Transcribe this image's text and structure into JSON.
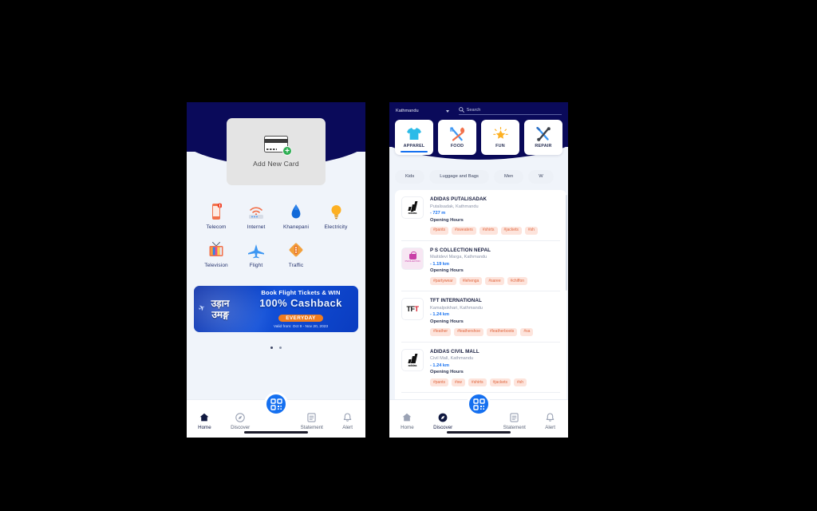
{
  "left_phone": {
    "add_card": {
      "label": "Add New Card",
      "icon": "credit-card-plus-icon"
    },
    "services": [
      {
        "label": "Telecom",
        "icon": "mobile-phone-icon"
      },
      {
        "label": "Internet",
        "icon": "wifi-router-icon"
      },
      {
        "label": "Khanepani",
        "icon": "water-drop-icon"
      },
      {
        "label": "Electricity",
        "icon": "light-bulb-icon"
      },
      {
        "label": "Television",
        "icon": "television-icon"
      },
      {
        "label": "Flight",
        "icon": "airplane-icon"
      },
      {
        "label": "Traffic",
        "icon": "traffic-light-icon"
      }
    ],
    "banner": {
      "brand_line1": "उड़ान",
      "brand_line2": "उमङ्ग",
      "headline": "Book Flight Tickets & WIN",
      "offer": "100% Cashback",
      "pill": "EVERYDAY",
      "validity": "Valid from: Oct 9 - Nov 20, 2023"
    },
    "carousel": {
      "total_dots": 2,
      "active_index": 0
    },
    "tabbar": [
      {
        "label": "Home",
        "icon": "home-icon",
        "active": true
      },
      {
        "label": "Discover",
        "icon": "compass-icon",
        "active": false
      },
      {
        "label": "Statement",
        "icon": "document-icon",
        "active": false
      },
      {
        "label": "Alert",
        "icon": "bell-icon",
        "active": false
      }
    ],
    "fab": {
      "icon": "qr-code-scan-icon"
    }
  },
  "right_phone": {
    "location": "Kathmandu",
    "search": {
      "placeholder": "Search",
      "icon": "search-icon"
    },
    "categories": [
      {
        "label": "APPAREL",
        "icon": "tshirt-icon",
        "active": true
      },
      {
        "label": "FOOD",
        "icon": "fork-spoon-icon",
        "active": false
      },
      {
        "label": "FUN",
        "icon": "star-sparkle-icon",
        "active": false
      },
      {
        "label": "REPAIR",
        "icon": "screwdriver-wrench-icon",
        "active": false
      }
    ],
    "chips": [
      "Kids",
      "Luggage and Bags",
      "Men",
      "W"
    ],
    "merchants": [
      {
        "name": "ADIDAS PUTALISADAK",
        "address": "Putalisadak, Kathmandu",
        "distance": "- 727 m",
        "hours_label": "Opening Hours",
        "logo": "adidas-logo",
        "tags": [
          "#pants",
          "#sweaters",
          "#shirts",
          "#jackets",
          "#sh"
        ]
      },
      {
        "name": "P S COLLECTION NEPAL",
        "address": "Maitidevi Marga, Kathmandu",
        "distance": "- 1.19 km",
        "hours_label": "Opening Hours",
        "logo": "ps-collection-logo",
        "tags": [
          "#partywear",
          "#lehenga",
          "#saree",
          "#chiffon"
        ]
      },
      {
        "name": "TFT INTERNATIONAL",
        "address": "Kamalpokhari, Kathmandu",
        "distance": "- 1.24 km",
        "hours_label": "Opening Hours",
        "logo": "tft-logo",
        "tags": [
          "#leather",
          "#leathershoe",
          "#leatherboots",
          "#sa"
        ]
      },
      {
        "name": "ADIDAS CIVIL MALL",
        "address": "Civil Mall, Kathmandu",
        "distance": "- 1.24 km",
        "hours_label": "Opening Hours",
        "logo": "adidas-logo",
        "tags": [
          "#pants",
          "#sw",
          "#shirts",
          "#jackets",
          "#sh"
        ]
      }
    ],
    "tabbar": [
      {
        "label": "Home",
        "icon": "home-icon",
        "active": false
      },
      {
        "label": "Discover",
        "icon": "compass-icon",
        "active": true
      },
      {
        "label": "Statement",
        "icon": "document-icon",
        "active": false
      },
      {
        "label": "Alert",
        "icon": "bell-icon",
        "active": false
      }
    ],
    "fab": {
      "icon": "qr-code-scan-icon"
    }
  },
  "colors": {
    "navy": "#0A0A5A",
    "accent_blue": "#1570F0",
    "tag_bg": "#FDE4DC",
    "tag_text": "#E0673F",
    "pill_orange": "#F07C1E",
    "page_bg": "#F0F4FA"
  }
}
